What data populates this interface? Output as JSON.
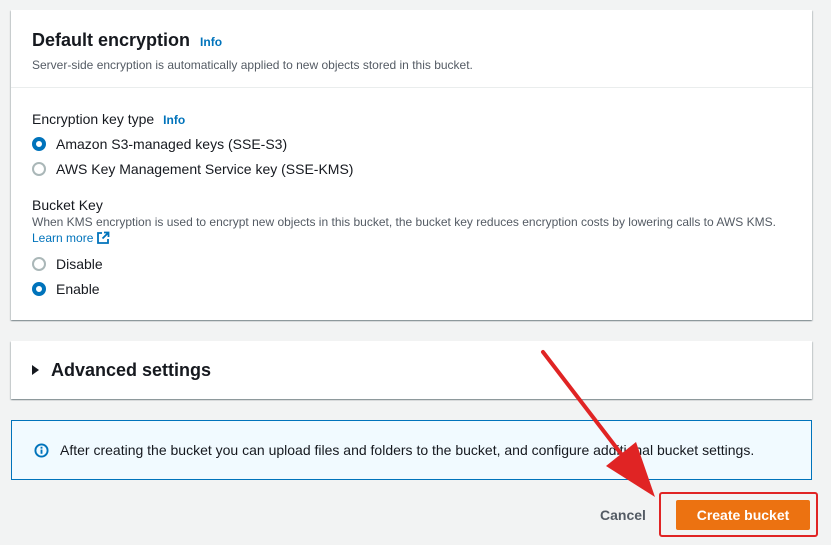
{
  "encryption": {
    "title": "Default encryption",
    "info_label": "Info",
    "description": "Server-side encryption is automatically applied to new objects stored in this bucket.",
    "key_type_label": "Encryption key type",
    "key_type_info": "Info",
    "options": [
      {
        "label": "Amazon S3-managed keys (SSE-S3)",
        "checked": true
      },
      {
        "label": "AWS Key Management Service key (SSE-KMS)",
        "checked": false
      }
    ],
    "bucket_key": {
      "label": "Bucket Key",
      "description": "When KMS encryption is used to encrypt new objects in this bucket, the bucket key reduces encryption costs by lowering calls to AWS KMS.",
      "learn_more": "Learn more",
      "options": [
        {
          "label": "Disable",
          "checked": false
        },
        {
          "label": "Enable",
          "checked": true
        }
      ]
    }
  },
  "advanced": {
    "title": "Advanced settings"
  },
  "alert": {
    "text": "After creating the bucket you can upload files and folders to the bucket, and configure additional bucket settings."
  },
  "footer": {
    "cancel_label": "Cancel",
    "create_label": "Create bucket"
  },
  "colors": {
    "accent": "#0073bb",
    "primary_button": "#ec7211",
    "annotation": "#e02424"
  },
  "icons": {
    "info": "info-circle-icon",
    "external": "external-link-icon",
    "expand": "caret-right-icon",
    "annotation": "red-arrow-icon"
  }
}
